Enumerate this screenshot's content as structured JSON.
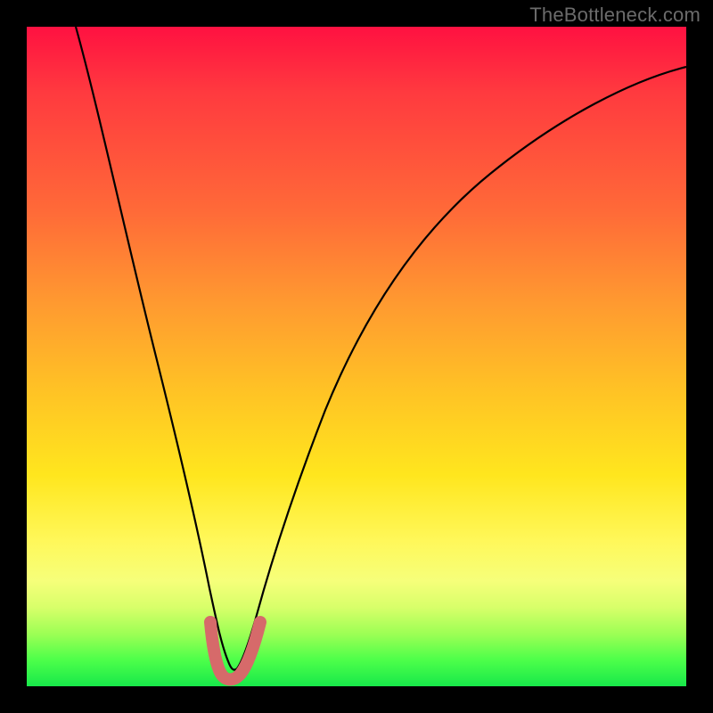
{
  "watermark": {
    "text": "TheBottleneck.com"
  },
  "colors": {
    "page_bg": "#000000",
    "watermark": "#6b6b6b",
    "curve": "#000000",
    "accent_bump": "#d66a6a"
  },
  "chart_data": {
    "type": "line",
    "title": "",
    "xlabel": "",
    "ylabel": "",
    "xlim": [
      0,
      100
    ],
    "ylim": [
      0,
      100
    ],
    "grid": false,
    "legend": false,
    "series": [
      {
        "name": "bottleneck-curve",
        "x": [
          0,
          4,
          8,
          12,
          16,
          20,
          24,
          26,
          28,
          29,
          30,
          31,
          32,
          34,
          36,
          40,
          45,
          50,
          55,
          60,
          70,
          80,
          90,
          100
        ],
        "y": [
          100,
          86,
          72,
          58,
          44,
          30,
          16,
          9,
          3,
          1,
          0,
          1,
          3,
          8,
          14,
          25,
          37,
          46,
          54,
          60,
          69,
          76,
          81,
          85
        ]
      }
    ],
    "annotations": [
      {
        "name": "min-region-U",
        "x_range": [
          26,
          34
        ],
        "y_range": [
          0,
          10
        ],
        "shape": "U",
        "note": "thick rounded U mark near minimum"
      }
    ]
  }
}
